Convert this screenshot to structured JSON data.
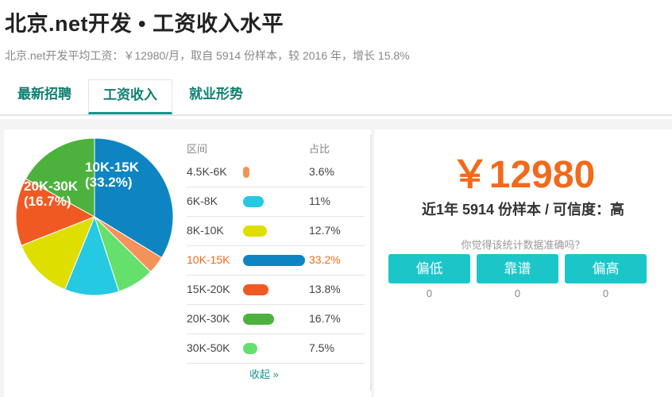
{
  "header": {
    "title": "北京.net开发 • 工资收入水平",
    "subtitle": "北京.net开发平均工资：￥12980/月，取自 5914 份样本，较 2016 年，增长 15.8%"
  },
  "tabs": [
    {
      "label": "最新招聘",
      "active": false
    },
    {
      "label": "工资收入",
      "active": true
    },
    {
      "label": "就业形势",
      "active": false
    }
  ],
  "distribution": {
    "col_range": "区间",
    "col_ratio": "占比",
    "rows": [
      {
        "range": "4.5K-6K",
        "pct": "3.6%",
        "value": 3.6,
        "color": "#f5925a",
        "highlight": false
      },
      {
        "range": "6K-8K",
        "pct": "11%",
        "value": 11,
        "color": "#25c9e1",
        "highlight": false
      },
      {
        "range": "8K-10K",
        "pct": "12.7%",
        "value": 12.7,
        "color": "#dede00",
        "highlight": false
      },
      {
        "range": "10K-15K",
        "pct": "33.2%",
        "value": 33.2,
        "color": "#0e85c2",
        "highlight": true
      },
      {
        "range": "15K-20K",
        "pct": "13.8%",
        "value": 13.8,
        "color": "#f05a22",
        "highlight": false
      },
      {
        "range": "20K-30K",
        "pct": "16.7%",
        "value": 16.7,
        "color": "#4db23d",
        "highlight": false
      },
      {
        "range": "30K-50K",
        "pct": "7.5%",
        "value": 7.5,
        "color": "#65e06c",
        "highlight": false
      }
    ],
    "collapse_label": "收起 »"
  },
  "pie_labels": [
    {
      "text": "10K-15K",
      "pct": "(33.2%)"
    },
    {
      "text": "20K-30K",
      "pct": "(16.7%)"
    }
  ],
  "summary": {
    "salary": "￥12980",
    "sample_line": "近1年 5914 份样本 / 可信度：高",
    "question": "你觉得该统计数据准确吗？",
    "votes": [
      {
        "label": "偏低",
        "count": "0"
      },
      {
        "label": "靠谱",
        "count": "0"
      },
      {
        "label": "偏高",
        "count": "0"
      }
    ]
  }
}
